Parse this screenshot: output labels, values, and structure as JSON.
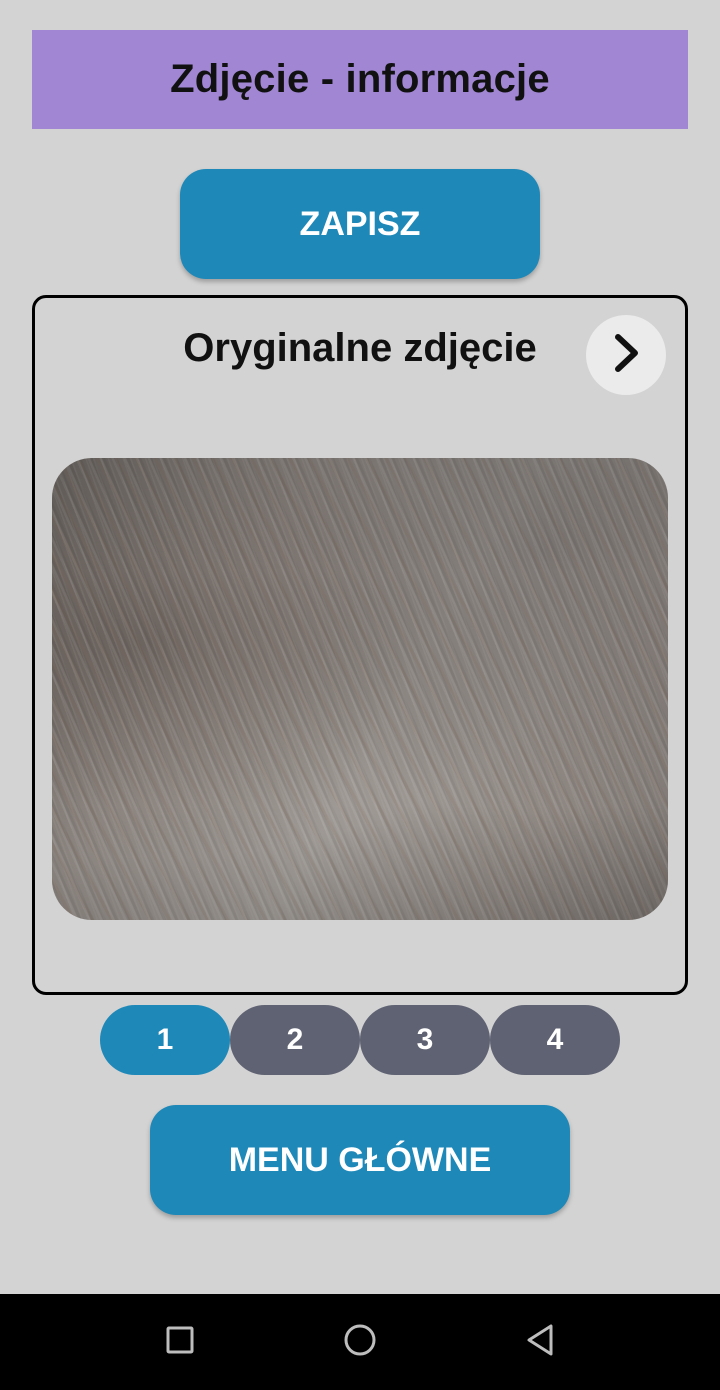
{
  "header": {
    "title": "Zdjęcie - informacje"
  },
  "actions": {
    "save_label": "ZAPISZ",
    "menu_label": "MENU GŁÓWNE"
  },
  "card": {
    "title": "Oryginalne zdjęcie",
    "next_icon": "chevron-right-icon"
  },
  "pager": {
    "pages": [
      "1",
      "2",
      "3",
      "4"
    ],
    "active_index": 0
  },
  "navbar": {
    "icons": [
      "recents-square-icon",
      "home-circle-icon",
      "back-triangle-icon"
    ]
  },
  "colors": {
    "header_bg": "#a086d3",
    "accent": "#1e88b8",
    "inactive_tab": "#5f6272",
    "background": "#d3d3d3"
  }
}
